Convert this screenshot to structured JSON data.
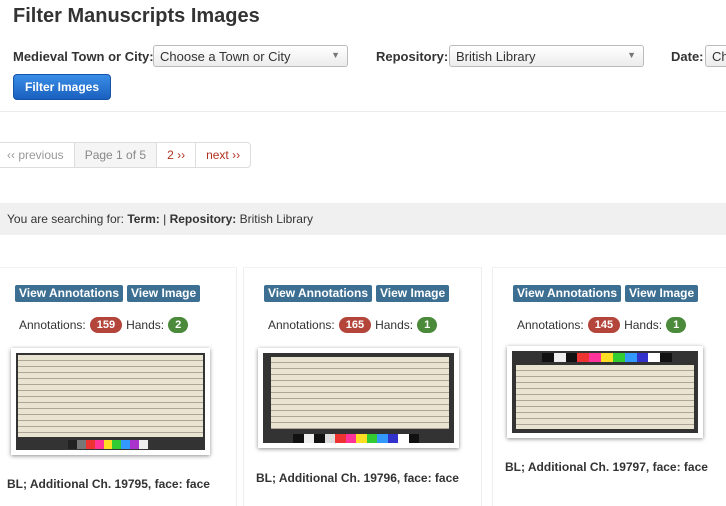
{
  "header": {
    "title": "Filter Manuscripts Images"
  },
  "filters": {
    "town_label": "Medieval Town or City:",
    "town_value": "Choose a Town or City",
    "repository_label": "Repository:",
    "repository_value": "British Library",
    "date_label": "Date:",
    "date_value": "Ch",
    "submit_label": "Filter Images"
  },
  "pagination": {
    "previous": "‹‹ previous",
    "current": "Page 1 of 5",
    "page2": "2 ››",
    "next": "next ››"
  },
  "search_summary": {
    "prefix": "You are searching for:",
    "term_label": "Term:",
    "separator": "|",
    "repository_label": "Repository:",
    "repository_value": "British Library"
  },
  "labels": {
    "view_annotations": "View Annotations",
    "view_image": "View Image",
    "annotations": "Annotations:",
    "hands": "Hands:"
  },
  "results": [
    {
      "annotations": "159",
      "hands": "2",
      "caption": "BL; Additional Ch. 19795, face: face"
    },
    {
      "annotations": "165",
      "hands": "1",
      "caption": "BL; Additional Ch. 19796, face: face"
    },
    {
      "annotations": "145",
      "hands": "1",
      "caption": "BL; Additional Ch. 19797, face: face"
    }
  ],
  "colors": {
    "primary_button": "#1a5fbf",
    "tag_button": "#3d6f92",
    "annotations_badge": "#b3453b",
    "hands_badge": "#4a8a3a",
    "link": "#b0311f"
  }
}
